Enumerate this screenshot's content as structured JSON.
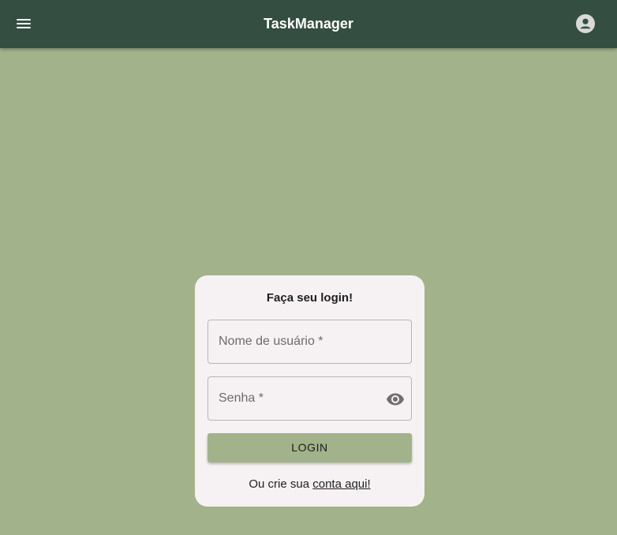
{
  "header": {
    "title": "TaskManager",
    "menu_icon": "menu-icon",
    "account_icon": "account-circle-icon"
  },
  "login_card": {
    "title": "Faça seu login!",
    "username_label": "Nome de usuário *",
    "password_label": "Senha *",
    "password_visibility_icon": "eye-icon",
    "login_button": "LOGIN",
    "signup_prefix": "Ou crie sua ",
    "signup_link": "conta aqui!"
  },
  "colors": {
    "header_bg": "#344e41",
    "page_bg": "#a2b28a",
    "card_bg": "#f6f2f3",
    "button_bg": "#a2b28a"
  }
}
